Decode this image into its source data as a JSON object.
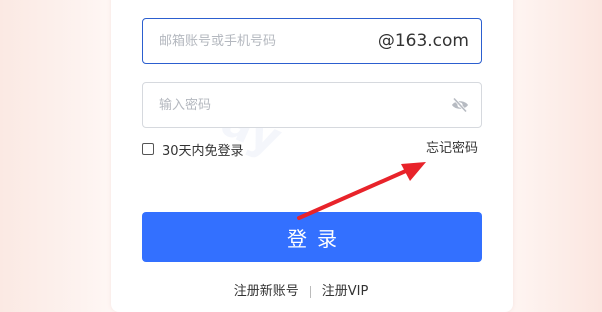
{
  "login_form": {
    "email": {
      "placeholder": "邮箱账号或手机号码",
      "value": "",
      "domain_suffix": "@163.com"
    },
    "password": {
      "placeholder": "输入密码",
      "value": "",
      "visibility_icon": "eye-off-icon"
    },
    "remember_me_label": "30天内免登录",
    "remember_me_checked": false,
    "forgot_password_label": "忘记密码",
    "login_button_label": "登录",
    "accent_color": "#3370ff"
  },
  "footer_links": {
    "register_label": "注册新账号",
    "register_vip_label": "注册VIP"
  },
  "annotation": {
    "arrow_color": "#e8232a"
  }
}
